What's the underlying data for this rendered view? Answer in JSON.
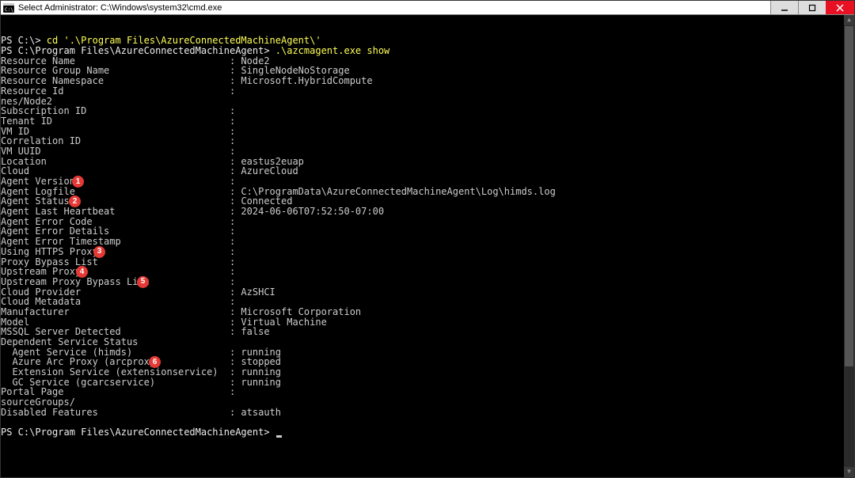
{
  "window": {
    "title": "Select Administrator: C:\\Windows\\system32\\cmd.exe"
  },
  "prompts": {
    "p1_prefix": "PS C:\\> ",
    "p1_cmd": "cd '.\\Program Files\\AzureConnectedMachineAgent\\'",
    "p2_prefix": "PS C:\\Program Files\\AzureConnectedMachineAgent> ",
    "p2_cmd": ".\\azcmagent.exe show",
    "p3_prefix": "PS C:\\Program Files\\AzureConnectedMachineAgent> "
  },
  "fields": [
    {
      "key": "Resource Name",
      "val": "Node2"
    },
    {
      "key": "Resource Group Name",
      "val": "SingleNodeNoStorage"
    },
    {
      "key": "Resource Namespace",
      "val": "Microsoft.HybridCompute"
    },
    {
      "key": "Resource Id",
      "val": ""
    },
    {
      "key": "nes/Node2",
      "noColon": true
    },
    {
      "key": "Subscription ID",
      "val": ""
    },
    {
      "key": "Tenant ID",
      "val": ""
    },
    {
      "key": "VM ID",
      "val": ""
    },
    {
      "key": "Correlation ID",
      "val": ""
    },
    {
      "key": "VM UUID",
      "val": ""
    },
    {
      "key": "Location",
      "val": "eastus2euap"
    },
    {
      "key": "Cloud",
      "val": "AzureCloud"
    },
    {
      "key": "Agent Version",
      "val": "",
      "badge": "1",
      "badgeLeft": 90
    },
    {
      "key": "Agent Logfile",
      "val": "C:\\ProgramData\\AzureConnectedMachineAgent\\Log\\himds.log"
    },
    {
      "key": "Agent Status",
      "val": "Connected",
      "badge": "2",
      "badgeLeft": 86
    },
    {
      "key": "Agent Last Heartbeat",
      "val": "2024-06-06T07:52:50-07:00"
    },
    {
      "key": "Agent Error Code",
      "val": ""
    },
    {
      "key": "Agent Error Details",
      "val": ""
    },
    {
      "key": "Agent Error Timestamp",
      "val": ""
    },
    {
      "key": "Using HTTPS Proxy",
      "val": "",
      "badge": "3",
      "badgeLeft": 117
    },
    {
      "key": "Proxy Bypass List",
      "val": ""
    },
    {
      "key": "Upstream Proxy",
      "val": "",
      "badge": "4",
      "badgeLeft": 95
    },
    {
      "key": "Upstream Proxy Bypass List",
      "val": "",
      "badge": "5",
      "badgeLeft": 172
    },
    {
      "key": "Cloud Provider",
      "val": "AzSHCI"
    },
    {
      "key": "Cloud Metadata",
      "val": ""
    },
    {
      "key": "Manufacturer",
      "val": "Microsoft Corporation"
    },
    {
      "key": "Model",
      "val": "Virtual Machine"
    },
    {
      "key": "MSSQL Server Detected",
      "val": "false"
    },
    {
      "key": "Dependent Service Status",
      "noColon": true
    },
    {
      "key": "  Agent Service (himds)",
      "val": "running"
    },
    {
      "key": "  Azure Arc Proxy (arcproxy)",
      "val": "stopped",
      "badge": "6",
      "badgeLeft": 187
    },
    {
      "key": "  Extension Service (extensionservice)",
      "val": "running",
      "wide": true
    },
    {
      "key": "  GC Service (gcarcservice)",
      "val": "running"
    },
    {
      "key": "Portal Page",
      "val": ""
    },
    {
      "key": "sourceGroups/",
      "noColon": true
    },
    {
      "key": "Disabled Features",
      "val": "atsauth"
    }
  ],
  "badges": {
    "b1": "1",
    "b2": "2",
    "b3": "3",
    "b4": "4",
    "b5": "5",
    "b6": "6"
  }
}
